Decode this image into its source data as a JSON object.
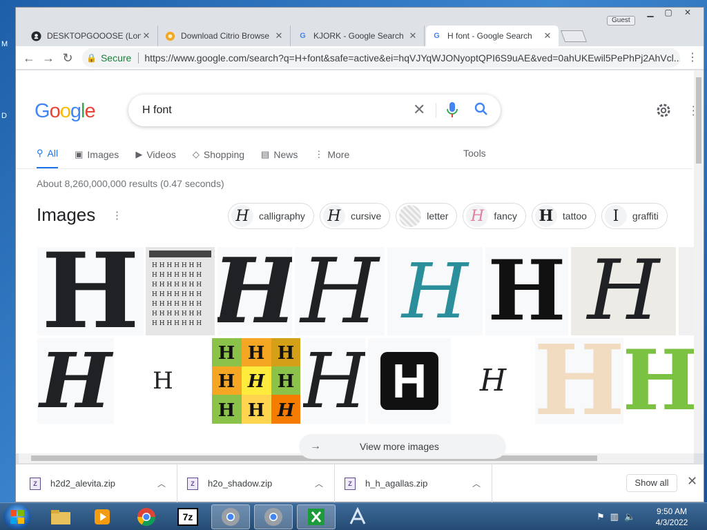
{
  "browser": {
    "tabs": [
      {
        "title": "DESKTOPGOOOSE (Long",
        "icon": "github-icon",
        "active": false
      },
      {
        "title": "Download Citrio Browse",
        "icon": "citrio-icon",
        "active": false
      },
      {
        "title": "KJORK - Google Search",
        "icon": "google-icon",
        "active": false
      },
      {
        "title": "H font - Google Search",
        "icon": "google-icon",
        "active": true
      }
    ],
    "guest_label": "Guest",
    "secure_label": "Secure",
    "url": "https://www.google.com/search?q=H+font&safe=active&ei=hqVJYqWJONyoptQPI6S9uAE&ved=0ahUKEwil5PePhPj2AhVcl..."
  },
  "search": {
    "logo_letters": [
      "G",
      "o",
      "o",
      "g",
      "l",
      "e"
    ],
    "logo_colors": [
      "#4285f4",
      "#ea4335",
      "#fbbc05",
      "#4285f4",
      "#34a853",
      "#ea4335"
    ],
    "query": "H font",
    "tabs": [
      {
        "label": "All",
        "icon": "search-icon",
        "active": true
      },
      {
        "label": "Images",
        "icon": "image-icon",
        "active": false
      },
      {
        "label": "Videos",
        "icon": "video-icon",
        "active": false
      },
      {
        "label": "Shopping",
        "icon": "tag-icon",
        "active": false
      },
      {
        "label": "News",
        "icon": "news-icon",
        "active": false
      },
      {
        "label": "More",
        "icon": "more-icon",
        "active": false
      }
    ],
    "tools_label": "Tools",
    "result_stats": "About 8,260,000,000 results (0.47 seconds)"
  },
  "images_section": {
    "heading": "Images",
    "chips": [
      "calligraphy",
      "cursive",
      "letter",
      "fancy",
      "tattoo",
      "graffiti"
    ],
    "view_more": "View more images"
  },
  "downloads": {
    "items": [
      "h2d2_alevita.zip",
      "h2o_shadow.zip",
      "h_h_agallas.zip"
    ],
    "show_all": "Show all"
  },
  "taskbar": {
    "time": "9:50 AM",
    "date": "4/3/2022"
  }
}
